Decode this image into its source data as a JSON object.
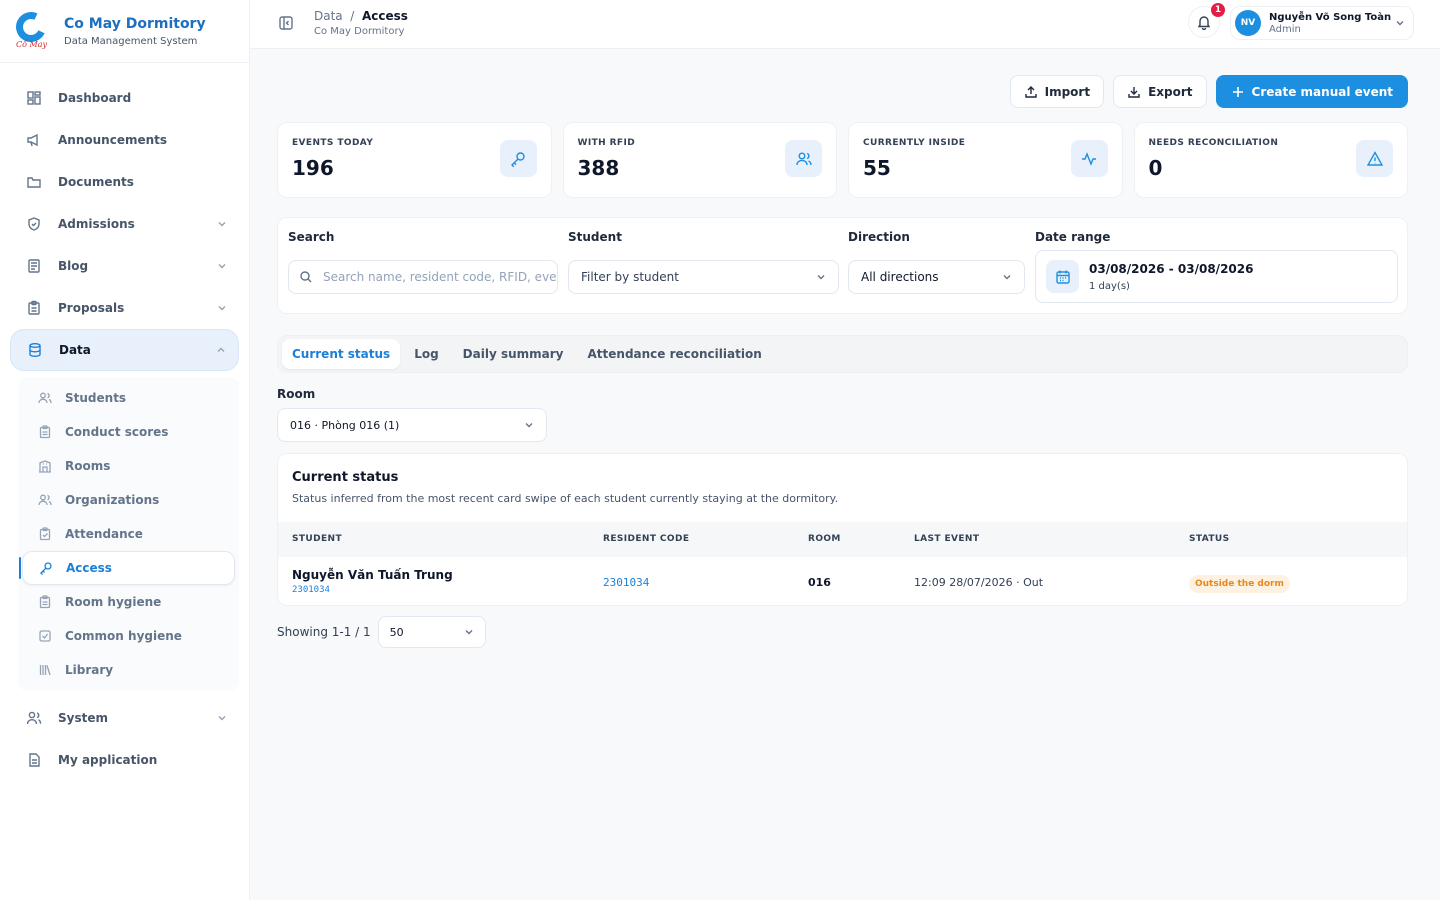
{
  "brand": {
    "name": "Co May Dormitory",
    "subtitle": "Data Management System",
    "logo_signature": "Cổ May"
  },
  "sidebar": {
    "items": [
      {
        "label": "Dashboard",
        "icon": "dashboard-icon"
      },
      {
        "label": "Announcements",
        "icon": "megaphone-icon"
      },
      {
        "label": "Documents",
        "icon": "folder-icon"
      },
      {
        "label": "Admissions",
        "icon": "shield-icon"
      },
      {
        "label": "Blog",
        "icon": "newspaper-icon"
      },
      {
        "label": "Proposals",
        "icon": "clipboard-icon"
      },
      {
        "label": "Data",
        "icon": "database-icon"
      },
      {
        "label": "System",
        "icon": "users-icon"
      },
      {
        "label": "My application",
        "icon": "file-icon"
      }
    ],
    "data_subitems": [
      {
        "label": "Students",
        "icon": "users-icon"
      },
      {
        "label": "Conduct scores",
        "icon": "clipboard-icon"
      },
      {
        "label": "Rooms",
        "icon": "building-icon"
      },
      {
        "label": "Organizations",
        "icon": "users-icon"
      },
      {
        "label": "Attendance",
        "icon": "clipboard-check-icon"
      },
      {
        "label": "Access",
        "icon": "key-icon"
      },
      {
        "label": "Room hygiene",
        "icon": "clipboard-icon"
      },
      {
        "label": "Common hygiene",
        "icon": "checkbox-icon"
      },
      {
        "label": "Library",
        "icon": "library-icon"
      }
    ]
  },
  "header": {
    "breadcrumb_parent": "Data",
    "breadcrumb_separator": "/",
    "breadcrumb_current": "Access",
    "subtitle": "Co May Dormitory",
    "notification_count": "1",
    "user": {
      "initials": "NV",
      "name": "Nguyễn Võ Song Toàn",
      "role": "Admin"
    }
  },
  "actions": {
    "import": "Import",
    "export": "Export",
    "create": "Create manual event"
  },
  "stats": [
    {
      "label": "EVENTS TODAY",
      "value": "196",
      "icon": "key-icon"
    },
    {
      "label": "WITH RFID",
      "value": "388",
      "icon": "users-icon"
    },
    {
      "label": "CURRENTLY INSIDE",
      "value": "55",
      "icon": "activity-icon"
    },
    {
      "label": "NEEDS RECONCILIATION",
      "value": "0",
      "icon": "warning-icon"
    }
  ],
  "filters": {
    "search_label": "Search",
    "search_placeholder": "Search name, resident code, RFID, eve",
    "student_label": "Student",
    "student_placeholder": "Filter by student",
    "direction_label": "Direction",
    "direction_value": "All directions",
    "date_label": "Date range",
    "date_value": "03/08/2026 - 03/08/2026",
    "date_days": "1 day(s)"
  },
  "tabs": [
    "Current status",
    "Log",
    "Daily summary",
    "Attendance reconciliation"
  ],
  "room": {
    "label": "Room",
    "value": "016 · Phòng 016 (1)"
  },
  "panel": {
    "title": "Current status",
    "description": "Status inferred from the most recent card swipe of each student currently staying at the dormitory.",
    "columns": [
      "STUDENT",
      "RESIDENT CODE",
      "ROOM",
      "LAST EVENT",
      "STATUS"
    ],
    "rows": [
      {
        "name": "Nguyễn Văn Tuấn Trung",
        "code_small": "2301034",
        "resident_code": "2301034",
        "room": "016",
        "last_event": "12:09 28/07/2026 · Out",
        "status": "Outside the dorm"
      }
    ]
  },
  "pagination": {
    "showing": "Showing 1-1 / 1",
    "per_page": "50"
  },
  "colors": {
    "accent": "#1d8fe0",
    "status_warning": "#e8891a",
    "badge": "#e11d48"
  }
}
